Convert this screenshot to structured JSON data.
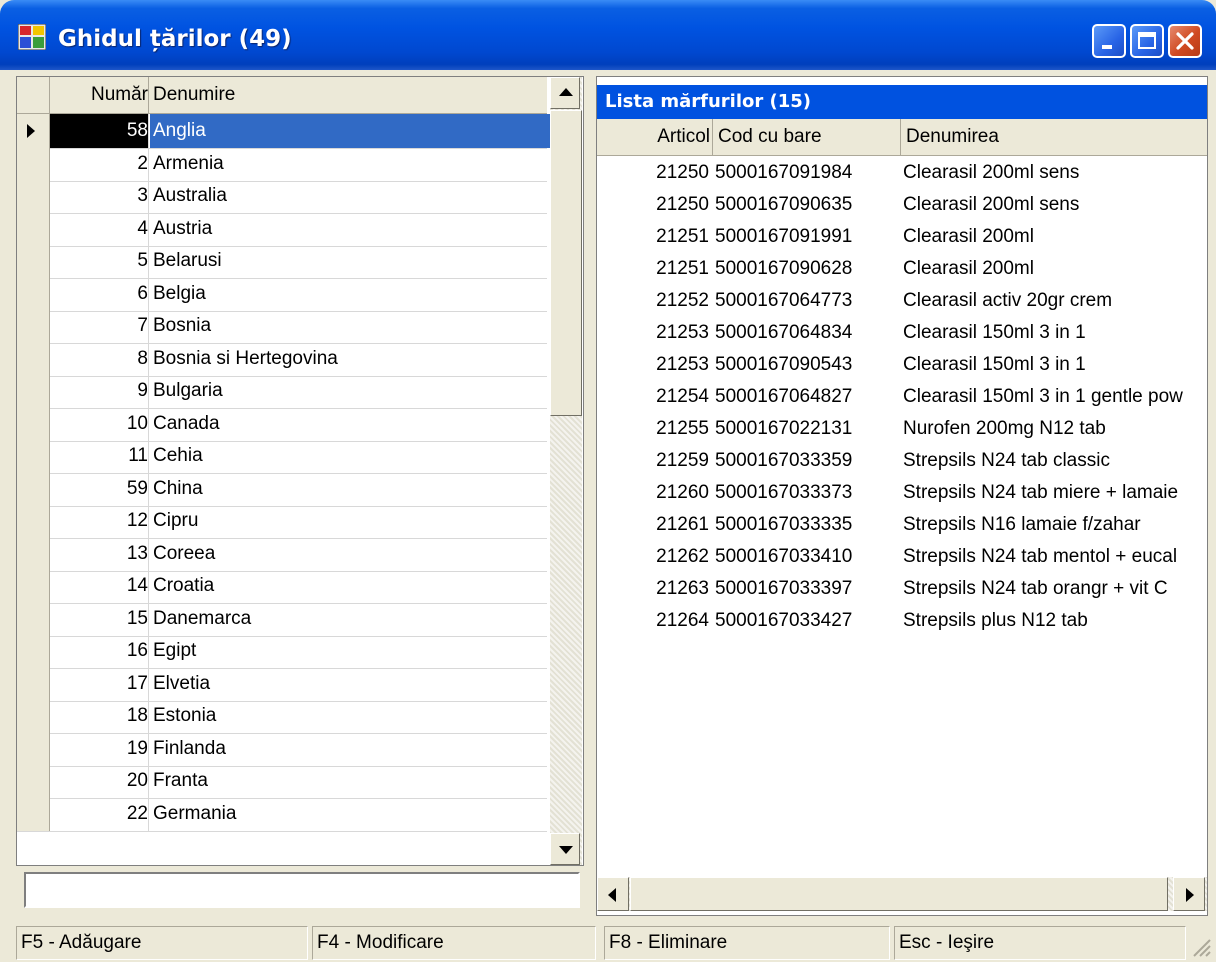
{
  "window": {
    "title": "Ghidul țărilor (49)"
  },
  "countries": {
    "headers": {
      "number": "Număr",
      "name": "Denumire"
    },
    "rows": [
      {
        "num": "58",
        "name": "Anglia"
      },
      {
        "num": "2",
        "name": "Armenia"
      },
      {
        "num": "3",
        "name": "Australia"
      },
      {
        "num": "4",
        "name": "Austria"
      },
      {
        "num": "5",
        "name": "Belarusi"
      },
      {
        "num": "6",
        "name": "Belgia"
      },
      {
        "num": "7",
        "name": "Bosnia"
      },
      {
        "num": "8",
        "name": "Bosnia si Hertegovina"
      },
      {
        "num": "9",
        "name": "Bulgaria"
      },
      {
        "num": "10",
        "name": "Canada"
      },
      {
        "num": "11",
        "name": "Cehia"
      },
      {
        "num": "59",
        "name": "China"
      },
      {
        "num": "12",
        "name": "Cipru"
      },
      {
        "num": "13",
        "name": "Coreea"
      },
      {
        "num": "14",
        "name": "Croatia"
      },
      {
        "num": "15",
        "name": "Danemarca"
      },
      {
        "num": "16",
        "name": "Egipt"
      },
      {
        "num": "17",
        "name": "Elvetia"
      },
      {
        "num": "18",
        "name": "Estonia"
      },
      {
        "num": "19",
        "name": "Finlanda"
      },
      {
        "num": "20",
        "name": "Franta"
      },
      {
        "num": "22",
        "name": "Germania"
      }
    ],
    "search_value": ""
  },
  "goods": {
    "caption": "Lista mărfurilor (15)",
    "headers": {
      "article": "Articol",
      "barcode": "Cod cu bare",
      "name": "Denumirea"
    },
    "rows": [
      {
        "art": "21250",
        "code": "5000167091984",
        "name": "Clearasil 200ml sens"
      },
      {
        "art": "21250",
        "code": "5000167090635",
        "name": "Clearasil 200ml sens"
      },
      {
        "art": "21251",
        "code": "5000167091991",
        "name": "Clearasil 200ml"
      },
      {
        "art": "21251",
        "code": "5000167090628",
        "name": "Clearasil 200ml"
      },
      {
        "art": "21252",
        "code": "5000167064773",
        "name": "Clearasil activ 20gr crem"
      },
      {
        "art": "21253",
        "code": "5000167064834",
        "name": "Clearasil 150ml 3 in 1"
      },
      {
        "art": "21253",
        "code": "5000167090543",
        "name": "Clearasil 150ml 3 in 1"
      },
      {
        "art": "21254",
        "code": "5000167064827",
        "name": "Clearasil 150ml  3 in 1  gentle pow"
      },
      {
        "art": "21255",
        "code": "5000167022131",
        "name": "Nurofen 200mg N12 tab"
      },
      {
        "art": "21259",
        "code": "5000167033359",
        "name": "Strepsils N24 tab classic"
      },
      {
        "art": "21260",
        "code": "5000167033373",
        "name": "Strepsils N24 tab miere + lamaie"
      },
      {
        "art": "21261",
        "code": "5000167033335",
        "name": "Strepsils N16 lamaie f/zahar"
      },
      {
        "art": "21262",
        "code": "5000167033410",
        "name": "Strepsils N24 tab mentol + eucal"
      },
      {
        "art": "21263",
        "code": "5000167033397",
        "name": "Strepsils N24 tab orangr + vit C"
      },
      {
        "art": "21264",
        "code": "5000167033427",
        "name": "Strepsils plus N12 tab"
      }
    ]
  },
  "statusbar": {
    "add": "F5 - Adăugare",
    "modify": "F4 - Modificare",
    "delete": "F8 - Eliminare",
    "exit": "Esc - Ieşire"
  },
  "colors": {
    "title_bar": "#0053e1",
    "selection": "#316ac5",
    "caption": "#0052e0"
  }
}
